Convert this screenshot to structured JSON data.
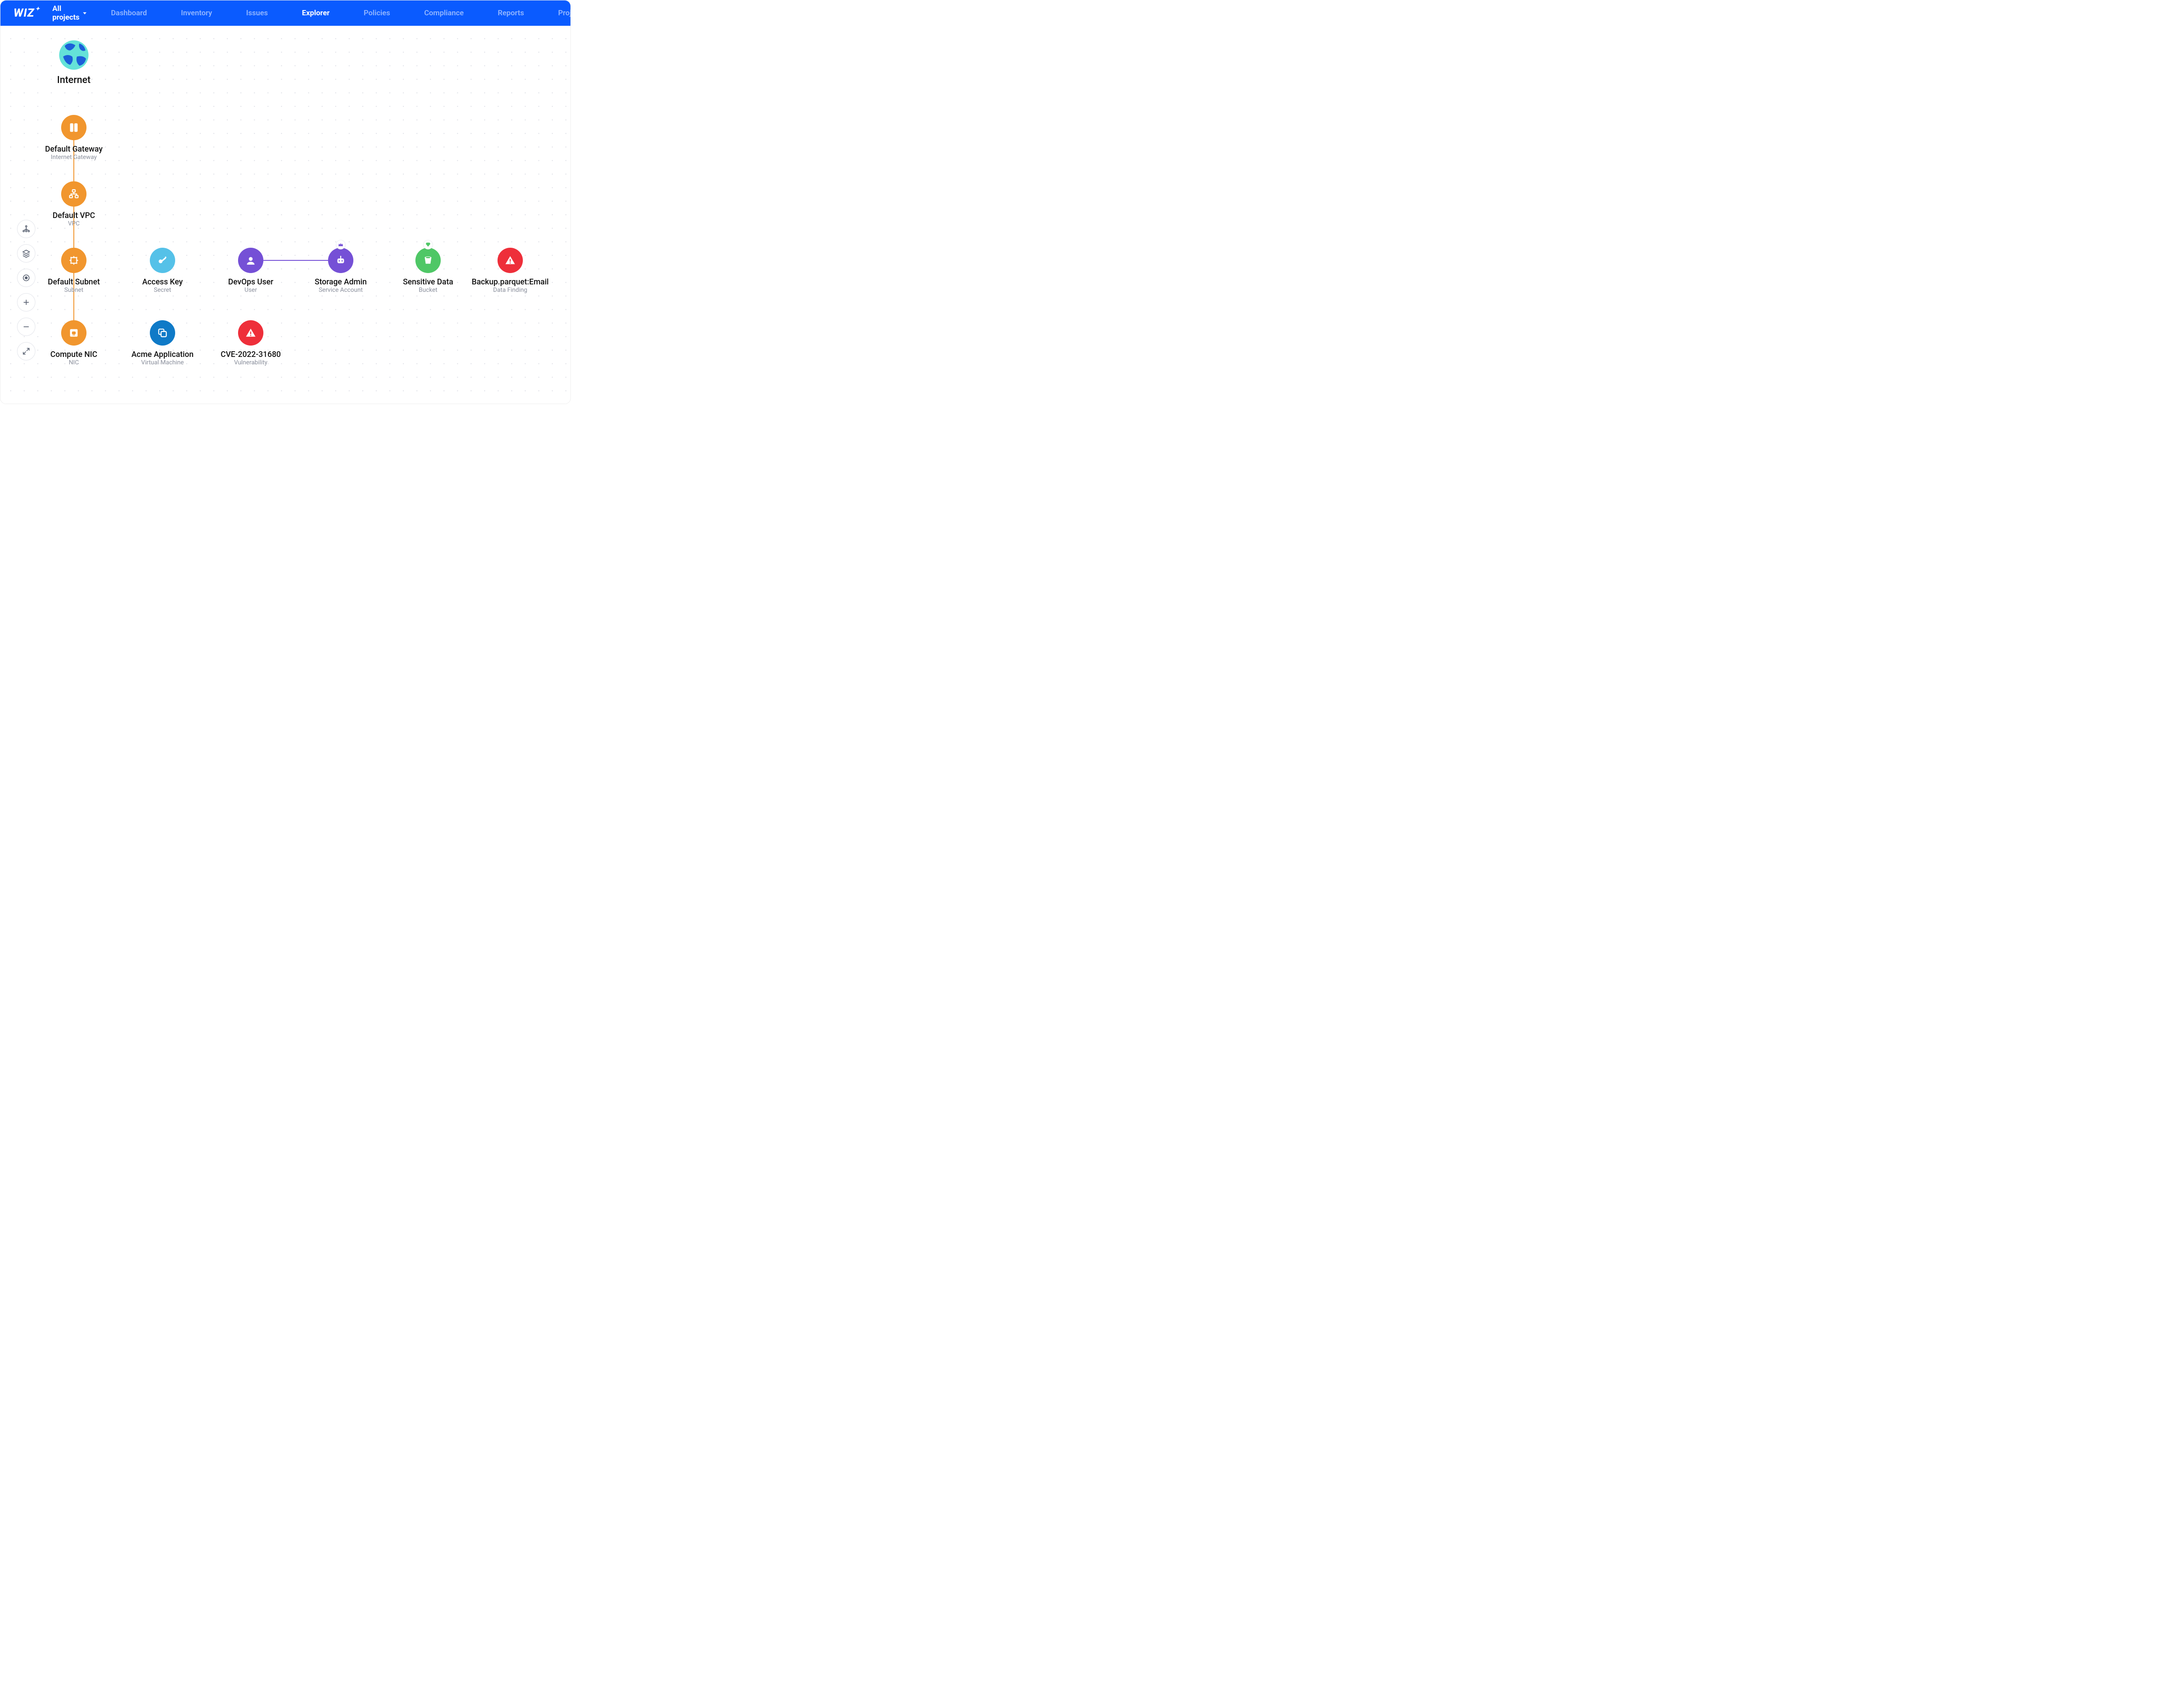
{
  "brand": "WIZ",
  "project_selector": {
    "label": "All projects"
  },
  "nav": {
    "items": [
      {
        "label": "Dashboard",
        "active": false
      },
      {
        "label": "Inventory",
        "active": false
      },
      {
        "label": "Issues",
        "active": false
      },
      {
        "label": "Explorer",
        "active": true
      },
      {
        "label": "Policies",
        "active": false
      },
      {
        "label": "Compliance",
        "active": false
      },
      {
        "label": "Reports",
        "active": false
      },
      {
        "label": "Projects",
        "active": false
      }
    ]
  },
  "toolbar": {
    "graph_icon": "graph-icon",
    "layers_icon": "layers-icon",
    "center_icon": "center-icon",
    "zoom_in_icon": "plus-icon",
    "zoom_out_icon": "minus-icon",
    "expand_icon": "expand-icon"
  },
  "nodes": {
    "internet": {
      "title": "Internet"
    },
    "gateway": {
      "title": "Default Gateway",
      "subtitle": "Internet Gateway"
    },
    "vpc": {
      "title": "Default VPC",
      "subtitle": "VPC"
    },
    "subnet": {
      "title": "Default Subnet",
      "subtitle": "Subnet"
    },
    "nic": {
      "title": "Compute NIC",
      "subtitle": "NIC"
    },
    "accesskey": {
      "title": "Access Key",
      "subtitle": "Secret"
    },
    "vm": {
      "title": "Acme Application",
      "subtitle": "Virtual Machine"
    },
    "cve": {
      "title": "CVE-2022-31680",
      "subtitle": "Vulnerability"
    },
    "devops": {
      "title": "DevOps User",
      "subtitle": "User"
    },
    "svcacct": {
      "title": "Storage Admin",
      "subtitle": "Service Account",
      "badge": "crown"
    },
    "bucket": {
      "title": "Sensitive Data",
      "subtitle": "Bucket",
      "badge": "diamond"
    },
    "finding": {
      "title": "Backup.parquet:Email",
      "subtitle": "Data Finding"
    }
  },
  "edges": [
    [
      "internet",
      "gateway"
    ],
    [
      "gateway",
      "vpc"
    ],
    [
      "vpc",
      "subnet"
    ],
    [
      "subnet",
      "nic"
    ],
    [
      "nic",
      "vm"
    ],
    [
      "vm",
      "cve"
    ],
    [
      "vm",
      "accesskey"
    ],
    [
      "accesskey",
      "devops"
    ],
    [
      "devops",
      "svcacct"
    ],
    [
      "svcacct",
      "bucket"
    ],
    [
      "bucket",
      "finding"
    ]
  ],
  "colors": {
    "orange": "#f1962e",
    "sky": "#55c1e8",
    "blue": "#0f7ac7",
    "purple": "#7550d6",
    "green": "#4fc766",
    "red": "#ee2f3a"
  }
}
